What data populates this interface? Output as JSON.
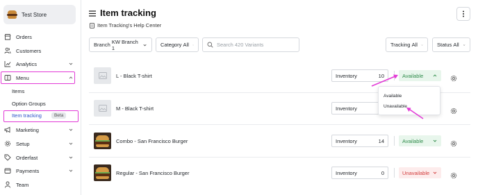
{
  "store": {
    "name": "Test Store"
  },
  "nav": {
    "orders": "Orders",
    "customers": "Customers",
    "analytics": "Analytics",
    "menu": "Menu",
    "sub_items": "Items",
    "sub_option_groups": "Option Groups",
    "sub_item_tracking": "Item tracking",
    "beta": "Beta",
    "marketing": "Marketing",
    "setup": "Setup",
    "orderfast": "Orderfast",
    "payments": "Payments",
    "team": "Team"
  },
  "header": {
    "title": "Item tracking",
    "help_link": "Item Tracking's Help Center"
  },
  "filters": {
    "branch_label": "Branch",
    "branch_value": "KW Branch 1",
    "category_label": "Category",
    "category_value": "All",
    "search_placeholder": "Search 420 Variants",
    "tracking_label": "Tracking",
    "tracking_value": "All",
    "status_label": "Status",
    "status_value": "All"
  },
  "rows": [
    {
      "name": "L - Black T-shirt",
      "inventory_label": "Inventory",
      "inventory": "10",
      "status": "Available",
      "status_kind": "ok",
      "thumb": "placeholder"
    },
    {
      "name": "M - Black T-shirt",
      "inventory_label": "Inventory",
      "inventory": "",
      "status": "",
      "status_kind": "hidden",
      "thumb": "placeholder"
    },
    {
      "name": "Combo - San Francisco Burger",
      "inventory_label": "Inventory",
      "inventory": "14",
      "status": "Available",
      "status_kind": "ok",
      "thumb": "burger"
    },
    {
      "name": "Regular - San Francisco Burger",
      "inventory_label": "Inventory",
      "inventory": "0",
      "status": "Unavailable",
      "status_kind": "bad",
      "thumb": "burger"
    }
  ],
  "status_dropdown": {
    "options": [
      "Available",
      "Unavailable"
    ]
  },
  "colors": {
    "annotation": "#e23ad6",
    "available": "#2e8b4a",
    "unavailable": "#d23c3c"
  },
  "icons": {
    "orders": "storefront-icon",
    "customers": "users-icon",
    "analytics": "chart-icon",
    "menu": "menu-book-icon",
    "marketing": "megaphone-icon",
    "setup": "gear-icon",
    "orderfast": "tag-icon",
    "payments": "wallet-icon",
    "team": "person-icon"
  }
}
